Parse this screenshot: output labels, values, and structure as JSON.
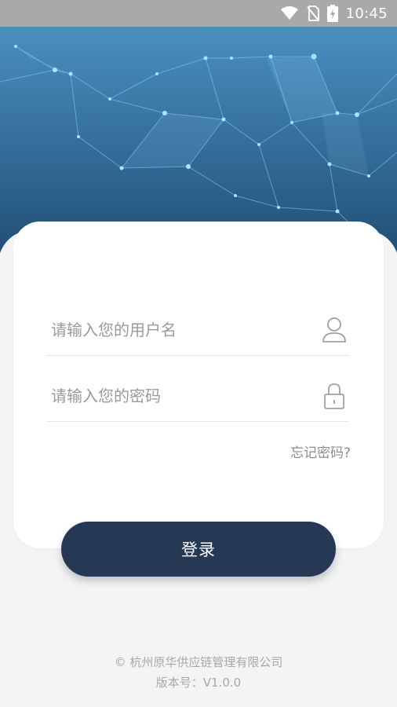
{
  "status_bar": {
    "time": "10:45",
    "icons": [
      "wifi-icon",
      "no-sim-icon",
      "battery-charging-icon"
    ]
  },
  "form": {
    "username_placeholder": "请输入您的用户名",
    "username_icon": "user-icon",
    "password_placeholder": "请输入您的密码",
    "password_icon": "lock-icon",
    "forgot_label": "忘记密码?"
  },
  "login_button_label": "登录",
  "footer": {
    "copyright": "© 杭州原华供应链管理有限公司",
    "version": "版本号：V1.0.0"
  },
  "colors": {
    "header_gradient_top": "#4a8fc1",
    "header_gradient_bottom": "#1f4d73",
    "button": "#253955",
    "network_line": "#7fd3ff"
  }
}
